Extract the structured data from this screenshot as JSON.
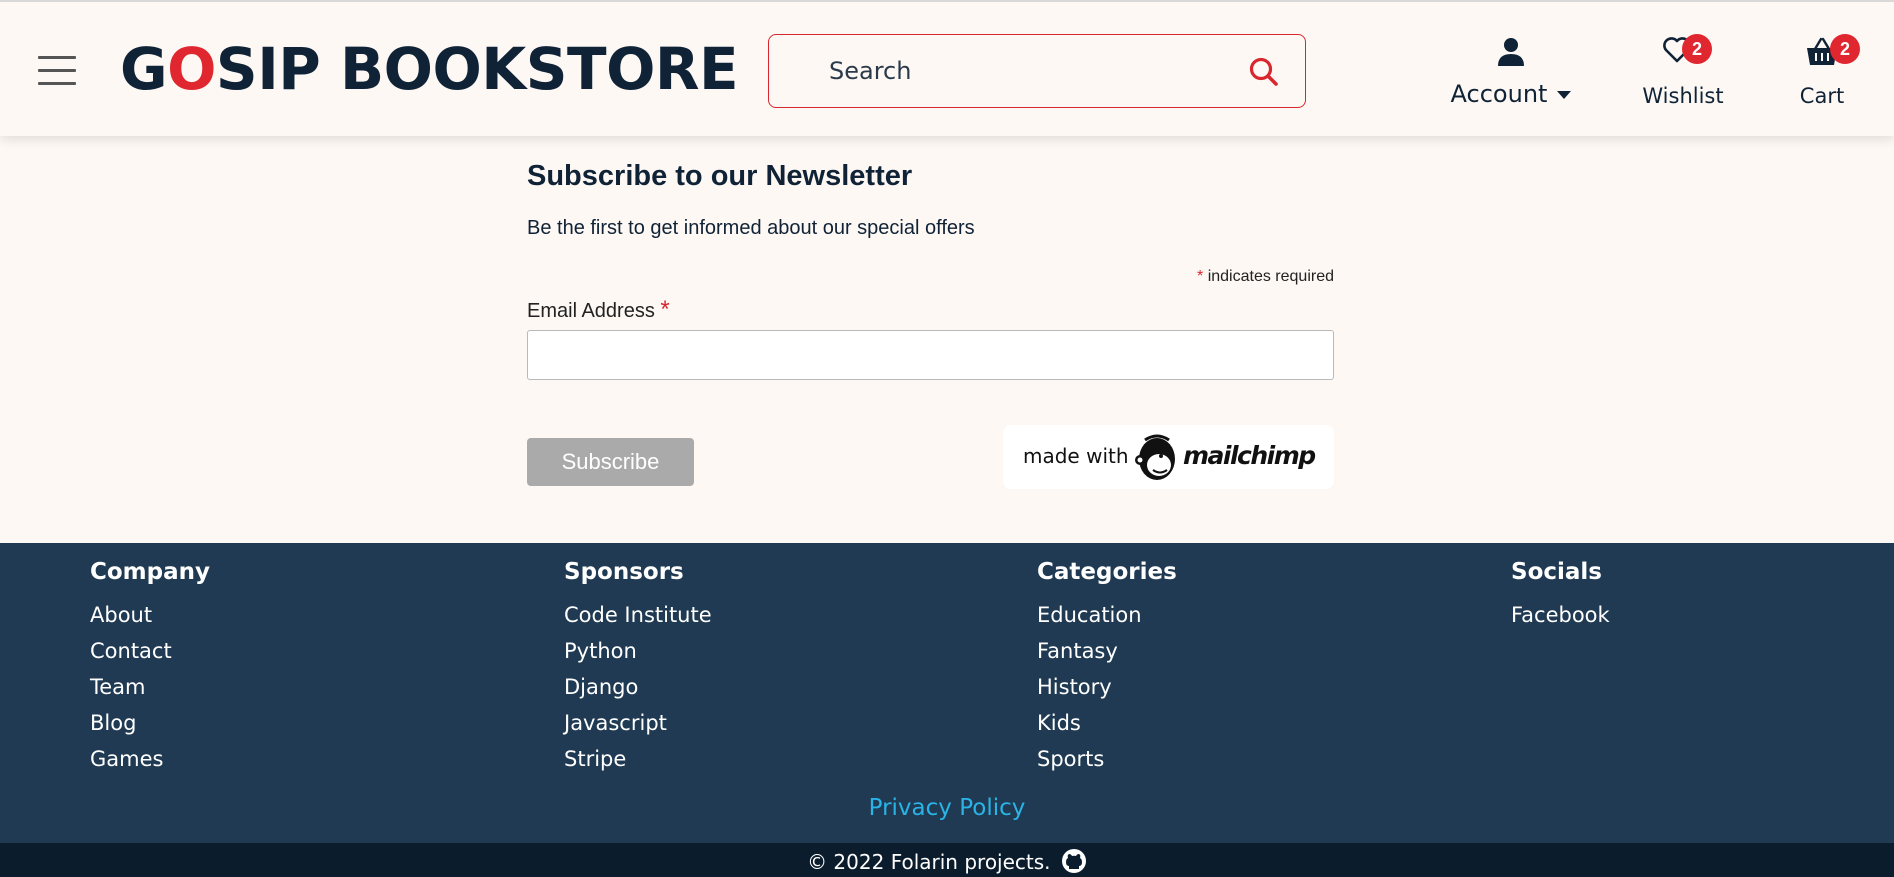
{
  "header": {
    "logo_first": "G",
    "logo_accent": "O",
    "logo_rest": "SIP BOOKSTORE",
    "search_placeholder": "Search",
    "account_label": "Account",
    "wishlist_label": "Wishlist",
    "wishlist_count": "2",
    "cart_label": "Cart",
    "cart_count": "2"
  },
  "newsletter": {
    "title": "Subscribe to our Newsletter",
    "subtitle": "Be the first to get informed about our special offers",
    "required_mark": "*",
    "required_note": " indicates required",
    "email_label": "Email Address",
    "email_value": "",
    "subscribe_label": "Subscribe",
    "made_with": "made with",
    "brand": "mailchimp"
  },
  "footer": {
    "columns": [
      {
        "title": "Company",
        "links": [
          "About",
          "Contact",
          "Team",
          "Blog",
          "Games"
        ]
      },
      {
        "title": "Sponsors",
        "links": [
          "Code Institute",
          "Python",
          "Django",
          "Javascript",
          "Stripe"
        ]
      },
      {
        "title": "Categories",
        "links": [
          "Education",
          "Fantasy",
          "History",
          "Kids",
          "Sports"
        ]
      },
      {
        "title": "Socials",
        "links": [
          "Facebook"
        ]
      }
    ],
    "privacy_label": "Privacy Policy",
    "copyright": "© 2022 Folarin projects."
  },
  "colors": {
    "accent_red": "#e0262f",
    "navy": "#0f2236",
    "footer_bg": "#1f3a52",
    "link_blue": "#2ab3e6"
  },
  "icons": [
    "menu-icon",
    "search-icon",
    "user-icon",
    "heart-icon",
    "basket-icon",
    "mailchimp-logo-icon",
    "github-icon"
  ]
}
